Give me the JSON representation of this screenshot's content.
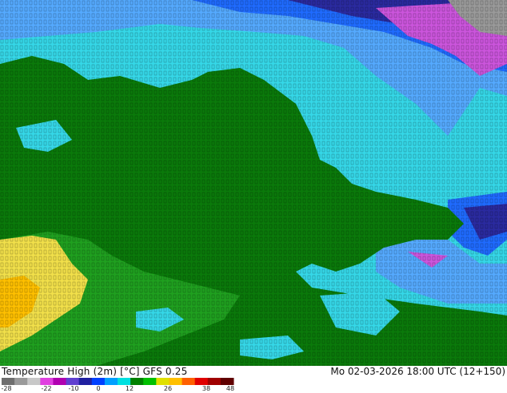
{
  "map": {
    "footer_title": "Temperature High (2m) [°C] GFS 0.25",
    "valid_time": "Mo 02-03-2026 18:00 UTC (12+150)",
    "legend": {
      "ticks": [
        "-28",
        "-22",
        "-10",
        "0",
        "12",
        "26",
        "38",
        "48"
      ],
      "colors": [
        "#6e6e6e",
        "#9a9a9a",
        "#c8c8c8",
        "#e040e0",
        "#b000b0",
        "#6040d0",
        "#2020a0",
        "#0040ff",
        "#00a0ff",
        "#00e0e0",
        "#008000",
        "#00c000",
        "#e0e000",
        "#ffc000",
        "#ff6000",
        "#e00000",
        "#a00000",
        "#600000"
      ]
    },
    "palette": {
      "land_green": "#0a7a0a",
      "cyan": "#35d8e8",
      "light_blue": "#55aaff",
      "blue": "#1f6bff",
      "dark_blue": "#2a2aa0",
      "magenta": "#cc55dd",
      "yellow": "#f2e04a"
    }
  }
}
